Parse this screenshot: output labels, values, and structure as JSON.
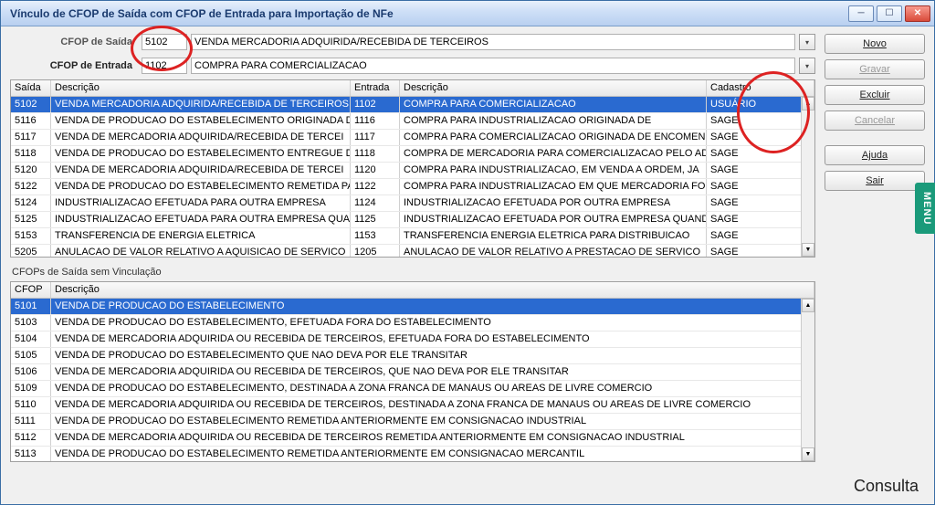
{
  "window": {
    "title": "Vínculo de CFOP de Saída com CFOP de Entrada para Importação de NFe"
  },
  "form": {
    "saida_label": "CFOP de Saída",
    "entrada_label": "CFOP de Entrada",
    "saida_code": "5102",
    "saida_desc": "VENDA MERCADORIA ADQUIRIDA/RECEBIDA DE TERCEIROS",
    "entrada_code": "1102",
    "entrada_desc": "COMPRA PARA COMERCIALIZACAO"
  },
  "toolbar": {
    "novo": "Novo",
    "gravar": "Gravar",
    "excluir": "Excluir",
    "cancelar": "Cancelar",
    "ajuda": "Ajuda",
    "sair": "Sair"
  },
  "grid1": {
    "headers": {
      "saida": "Saída",
      "desc_s": "Descrição",
      "entrada": "Entrada",
      "desc_e": "Descrição",
      "cad": "Cadastro"
    },
    "rows": [
      {
        "saida": "5102",
        "desc_s": "VENDA MERCADORIA ADQUIRIDA/RECEBIDA DE TERCEIROS",
        "entrada": "1102",
        "desc_e": "COMPRA PARA COMERCIALIZACAO",
        "cad": "USUÁRIO",
        "sel": true
      },
      {
        "saida": "5116",
        "desc_s": "VENDA DE PRODUCAO DO ESTABELECIMENTO ORIGINADA DE",
        "entrada": "1116",
        "desc_e": "COMPRA PARA INDUSTRIALIZACAO ORIGINADA DE",
        "cad": "SAGE"
      },
      {
        "saida": "5117",
        "desc_s": "VENDA DE MERCADORIA ADQUIRIDA/RECEBIDA DE TERCEI",
        "entrada": "1117",
        "desc_e": "COMPRA PARA COMERCIALIZACAO ORIGINADA DE ENCOMENDA",
        "cad": "SAGE"
      },
      {
        "saida": "5118",
        "desc_s": "VENDA DE PRODUCAO DO ESTABELECIMENTO ENTREGUE DE",
        "entrada": "1118",
        "desc_e": "COMPRA DE MERCADORIA PARA COMERCIALIZACAO PELO AD",
        "cad": "SAGE"
      },
      {
        "saida": "5120",
        "desc_s": "VENDA DE MERCADORIA ADQUIRIDA/RECEBIDA DE TERCEI",
        "entrada": "1120",
        "desc_e": "COMPRA PARA INDUSTRIALIZACAO, EM VENDA A ORDEM, JA",
        "cad": "SAGE"
      },
      {
        "saida": "5122",
        "desc_s": "VENDA DE PRODUCAO DO ESTABELECIMENTO REMETIDA PARA",
        "entrada": "1122",
        "desc_e": "COMPRA PARA INDUSTRIALIZACAO EM QUE MERCADORIA FOI",
        "cad": "SAGE"
      },
      {
        "saida": "5124",
        "desc_s": "INDUSTRIALIZACAO EFETUADA PARA OUTRA EMPRESA",
        "entrada": "1124",
        "desc_e": "INDUSTRIALIZACAO EFETUADA POR OUTRA EMPRESA",
        "cad": "SAGE"
      },
      {
        "saida": "5125",
        "desc_s": "INDUSTRIALIZACAO EFETUADA PARA OUTRA EMPRESA QUAND",
        "entrada": "1125",
        "desc_e": "INDUSTRIALIZACAO EFETUADA POR OUTRA EMPRESA QUANDO",
        "cad": "SAGE"
      },
      {
        "saida": "5153",
        "desc_s": "TRANSFERENCIA DE ENERGIA ELETRICA",
        "entrada": "1153",
        "desc_e": "TRANSFERENCIA ENERGIA ELETRICA PARA DISTRIBUICAO",
        "cad": "SAGE"
      },
      {
        "saida": "5205",
        "desc_s": "ANULACAO DE VALOR RELATIVO A AQUISICAO DE SERVICO",
        "entrada": "1205",
        "desc_e": "ANULACAO DE VALOR RELATIVO A PRESTACAO DE SERVICO",
        "cad": "SAGE"
      }
    ]
  },
  "sectionlabel": "CFOPs de Saída sem Vinculação",
  "grid2": {
    "headers": {
      "cfop": "CFOP",
      "desc": "Descrição"
    },
    "rows": [
      {
        "cfop": "5101",
        "desc": "VENDA DE PRODUCAO DO ESTABELECIMENTO",
        "sel": true
      },
      {
        "cfop": "5103",
        "desc": "VENDA DE PRODUCAO DO ESTABELECIMENTO, EFETUADA FORA DO ESTABELECIMENTO"
      },
      {
        "cfop": "5104",
        "desc": "VENDA DE MERCADORIA ADQUIRIDA OU RECEBIDA DE TERCEIROS, EFETUADA FORA DO ESTABELECIMENTO"
      },
      {
        "cfop": "5105",
        "desc": "VENDA DE PRODUCAO DO ESTABELECIMENTO QUE NAO DEVA POR ELE TRANSITAR"
      },
      {
        "cfop": "5106",
        "desc": "VENDA DE MERCADORIA ADQUIRIDA OU RECEBIDA DE TERCEIROS, QUE NAO DEVA POR ELE TRANSITAR"
      },
      {
        "cfop": "5109",
        "desc": "VENDA DE PRODUCAO DO ESTABELECIMENTO, DESTINADA A ZONA FRANCA DE MANAUS OU AREAS DE LIVRE COMERCIO"
      },
      {
        "cfop": "5110",
        "desc": "VENDA DE MERCADORIA ADQUIRIDA OU RECEBIDA DE TERCEIROS, DESTINADA A ZONA FRANCA DE MANAUS OU AREAS DE LIVRE COMERCIO"
      },
      {
        "cfop": "5111",
        "desc": "VENDA DE PRODUCAO DO ESTABELECIMENTO REMETIDA ANTERIORMENTE EM CONSIGNACAO INDUSTRIAL"
      },
      {
        "cfop": "5112",
        "desc": "VENDA DE MERCADORIA ADQUIRIDA OU RECEBIDA DE TERCEIROS REMETIDA ANTERIORMENTE EM CONSIGNACAO INDUSTRIAL"
      },
      {
        "cfop": "5113",
        "desc": "VENDA DE PRODUCAO DO ESTABELECIMENTO REMETIDA ANTERIORMENTE EM CONSIGNACAO MERCANTIL"
      }
    ]
  },
  "status": "Consulta",
  "menutab": "MENU"
}
